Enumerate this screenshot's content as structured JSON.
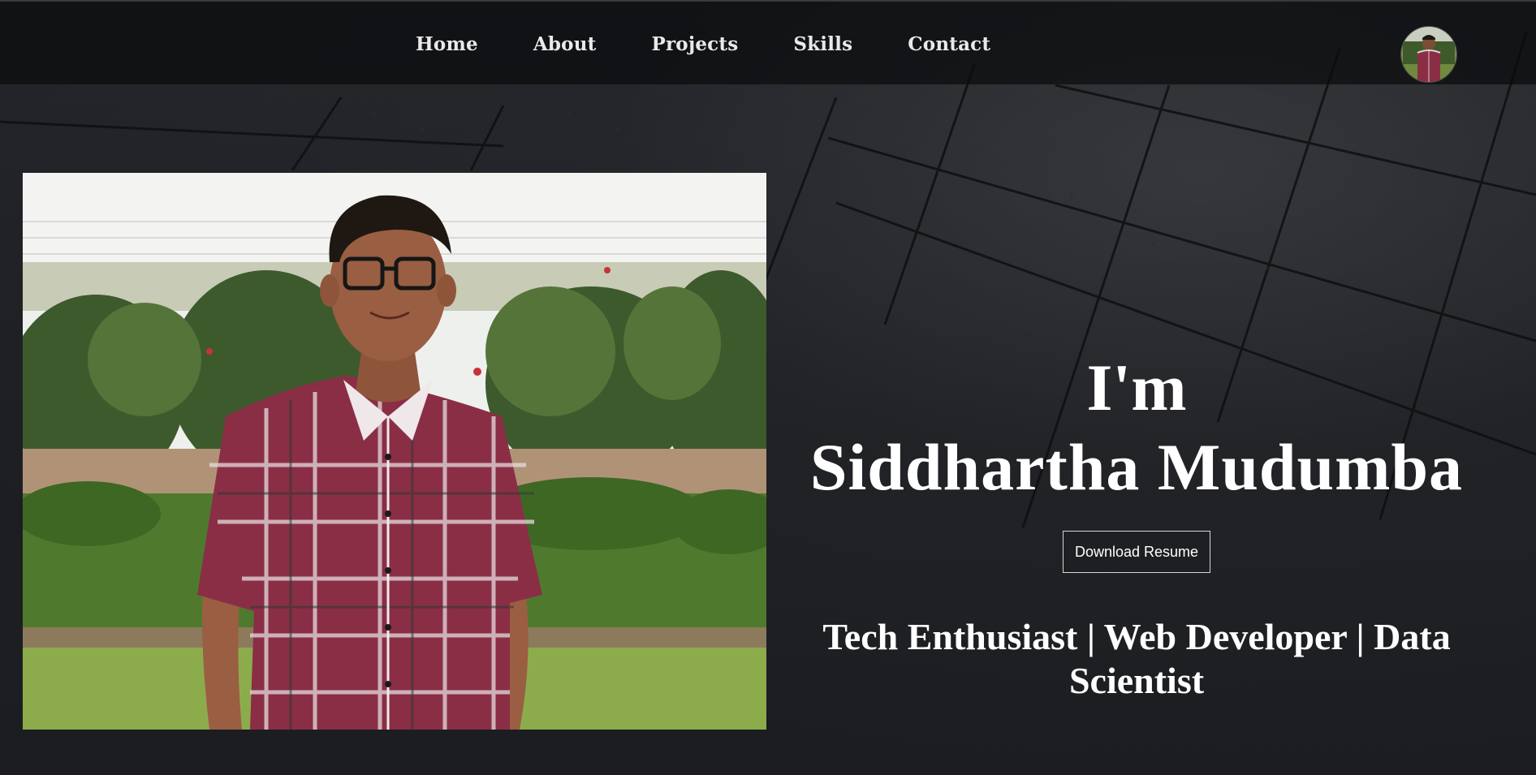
{
  "nav": {
    "items": [
      {
        "label": "Home"
      },
      {
        "label": "About"
      },
      {
        "label": "Projects"
      },
      {
        "label": "Skills"
      },
      {
        "label": "Contact"
      }
    ]
  },
  "hero": {
    "greeting": "I'm",
    "name": "Siddhartha Mudumba",
    "resume_button": "Download Resume",
    "tagline": "Tech Enthusiast | Web Developer | Data Scientist"
  },
  "colors": {
    "background": "#1c1e22",
    "navbar": "#0a0b0c",
    "text": "#ffffff",
    "shirt_red": "#8a2e46"
  },
  "icons": {
    "avatar": "profile-photo-avatar",
    "photo": "profile-photo"
  }
}
